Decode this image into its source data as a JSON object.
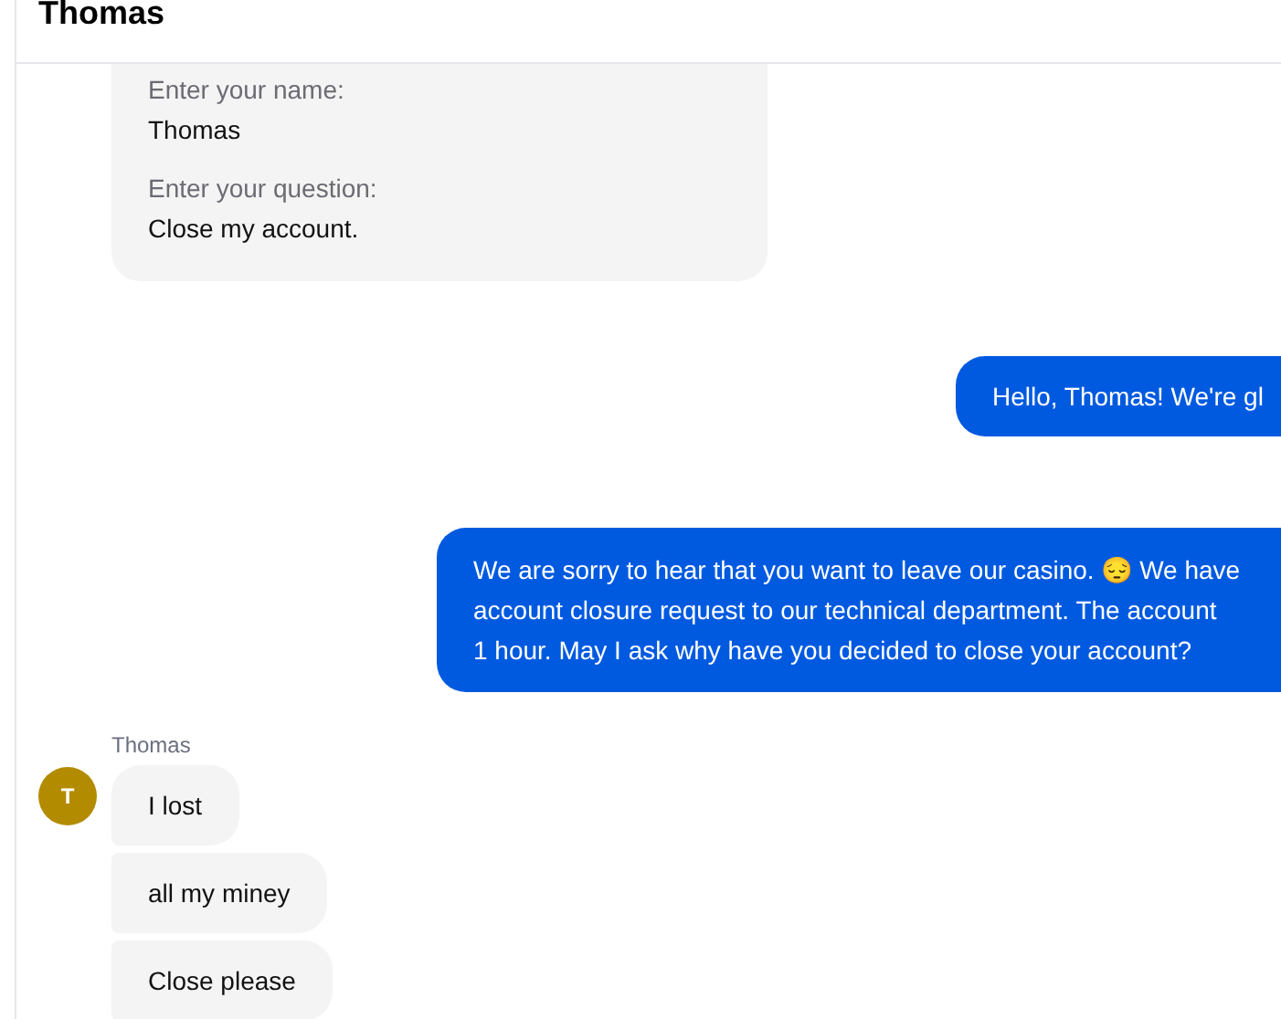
{
  "header": {
    "title": "Thomas"
  },
  "messages": [
    {
      "kind": "form",
      "fields": [
        {
          "label": "Enter your name:",
          "value": "Thomas"
        },
        {
          "label": "Enter your question:",
          "value": "Close my account."
        }
      ]
    },
    {
      "kind": "outgoing",
      "text": "Hello, Thomas! We're gl"
    },
    {
      "kind": "outgoing",
      "text": "We are sorry to hear that you want to leave our casino. 😔 We have\naccount closure request to our technical department. The account\n1 hour. May I ask why have you decided to close your account?"
    },
    {
      "kind": "incoming",
      "sender": "Thomas",
      "avatar": "T",
      "bubbles": [
        "I lost",
        "all my miney",
        "Close please"
      ]
    }
  ]
}
